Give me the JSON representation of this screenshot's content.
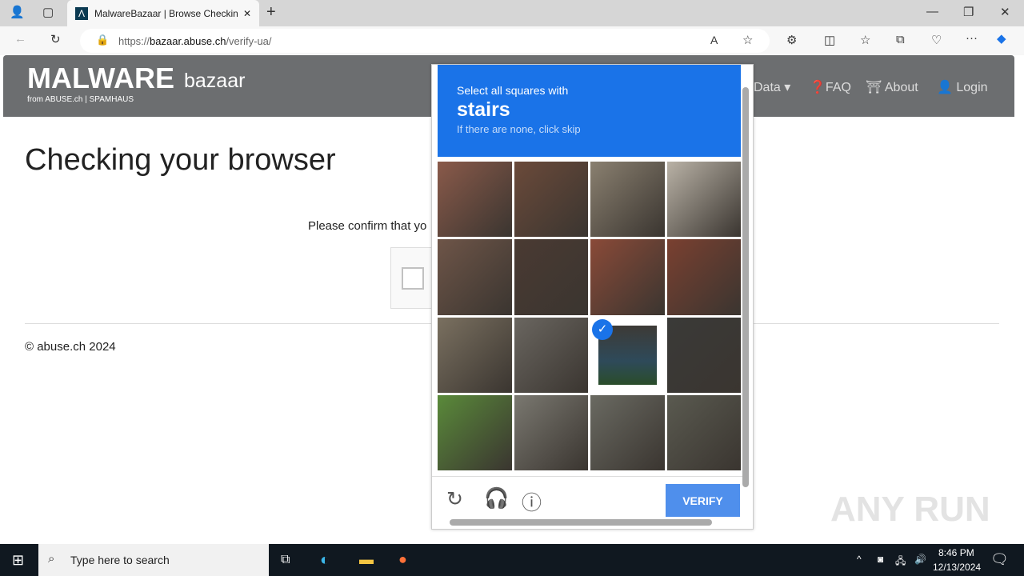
{
  "browser": {
    "tab_title": "MalwareBazaar | Browse Checkin",
    "url_prefix": "https://",
    "url_host": "bazaar.abuse.ch",
    "url_path": "/verify-ua/"
  },
  "site": {
    "logo_main": "MALWARE",
    "logo_sub": "bazaar",
    "logo_from": "from ABUSE.ch | SPAMHAUS",
    "nav": [
      "Data",
      "FAQ",
      "About",
      "Login"
    ]
  },
  "main": {
    "title": "Checking your browser",
    "confirm_text": "Please confirm that yo",
    "footer": "© abuse.ch 2024"
  },
  "captcha": {
    "prompt": "Select all squares with",
    "target": "stairs",
    "hint": "If there are none, click skip",
    "verify_label": "VERIFY",
    "selected_tiles": [
      10
    ],
    "accent": "#1a73e8"
  },
  "taskbar": {
    "search_placeholder": "Type here to search",
    "time": "8:46 PM",
    "date": "12/13/2024"
  },
  "watermark": "ANY RUN"
}
